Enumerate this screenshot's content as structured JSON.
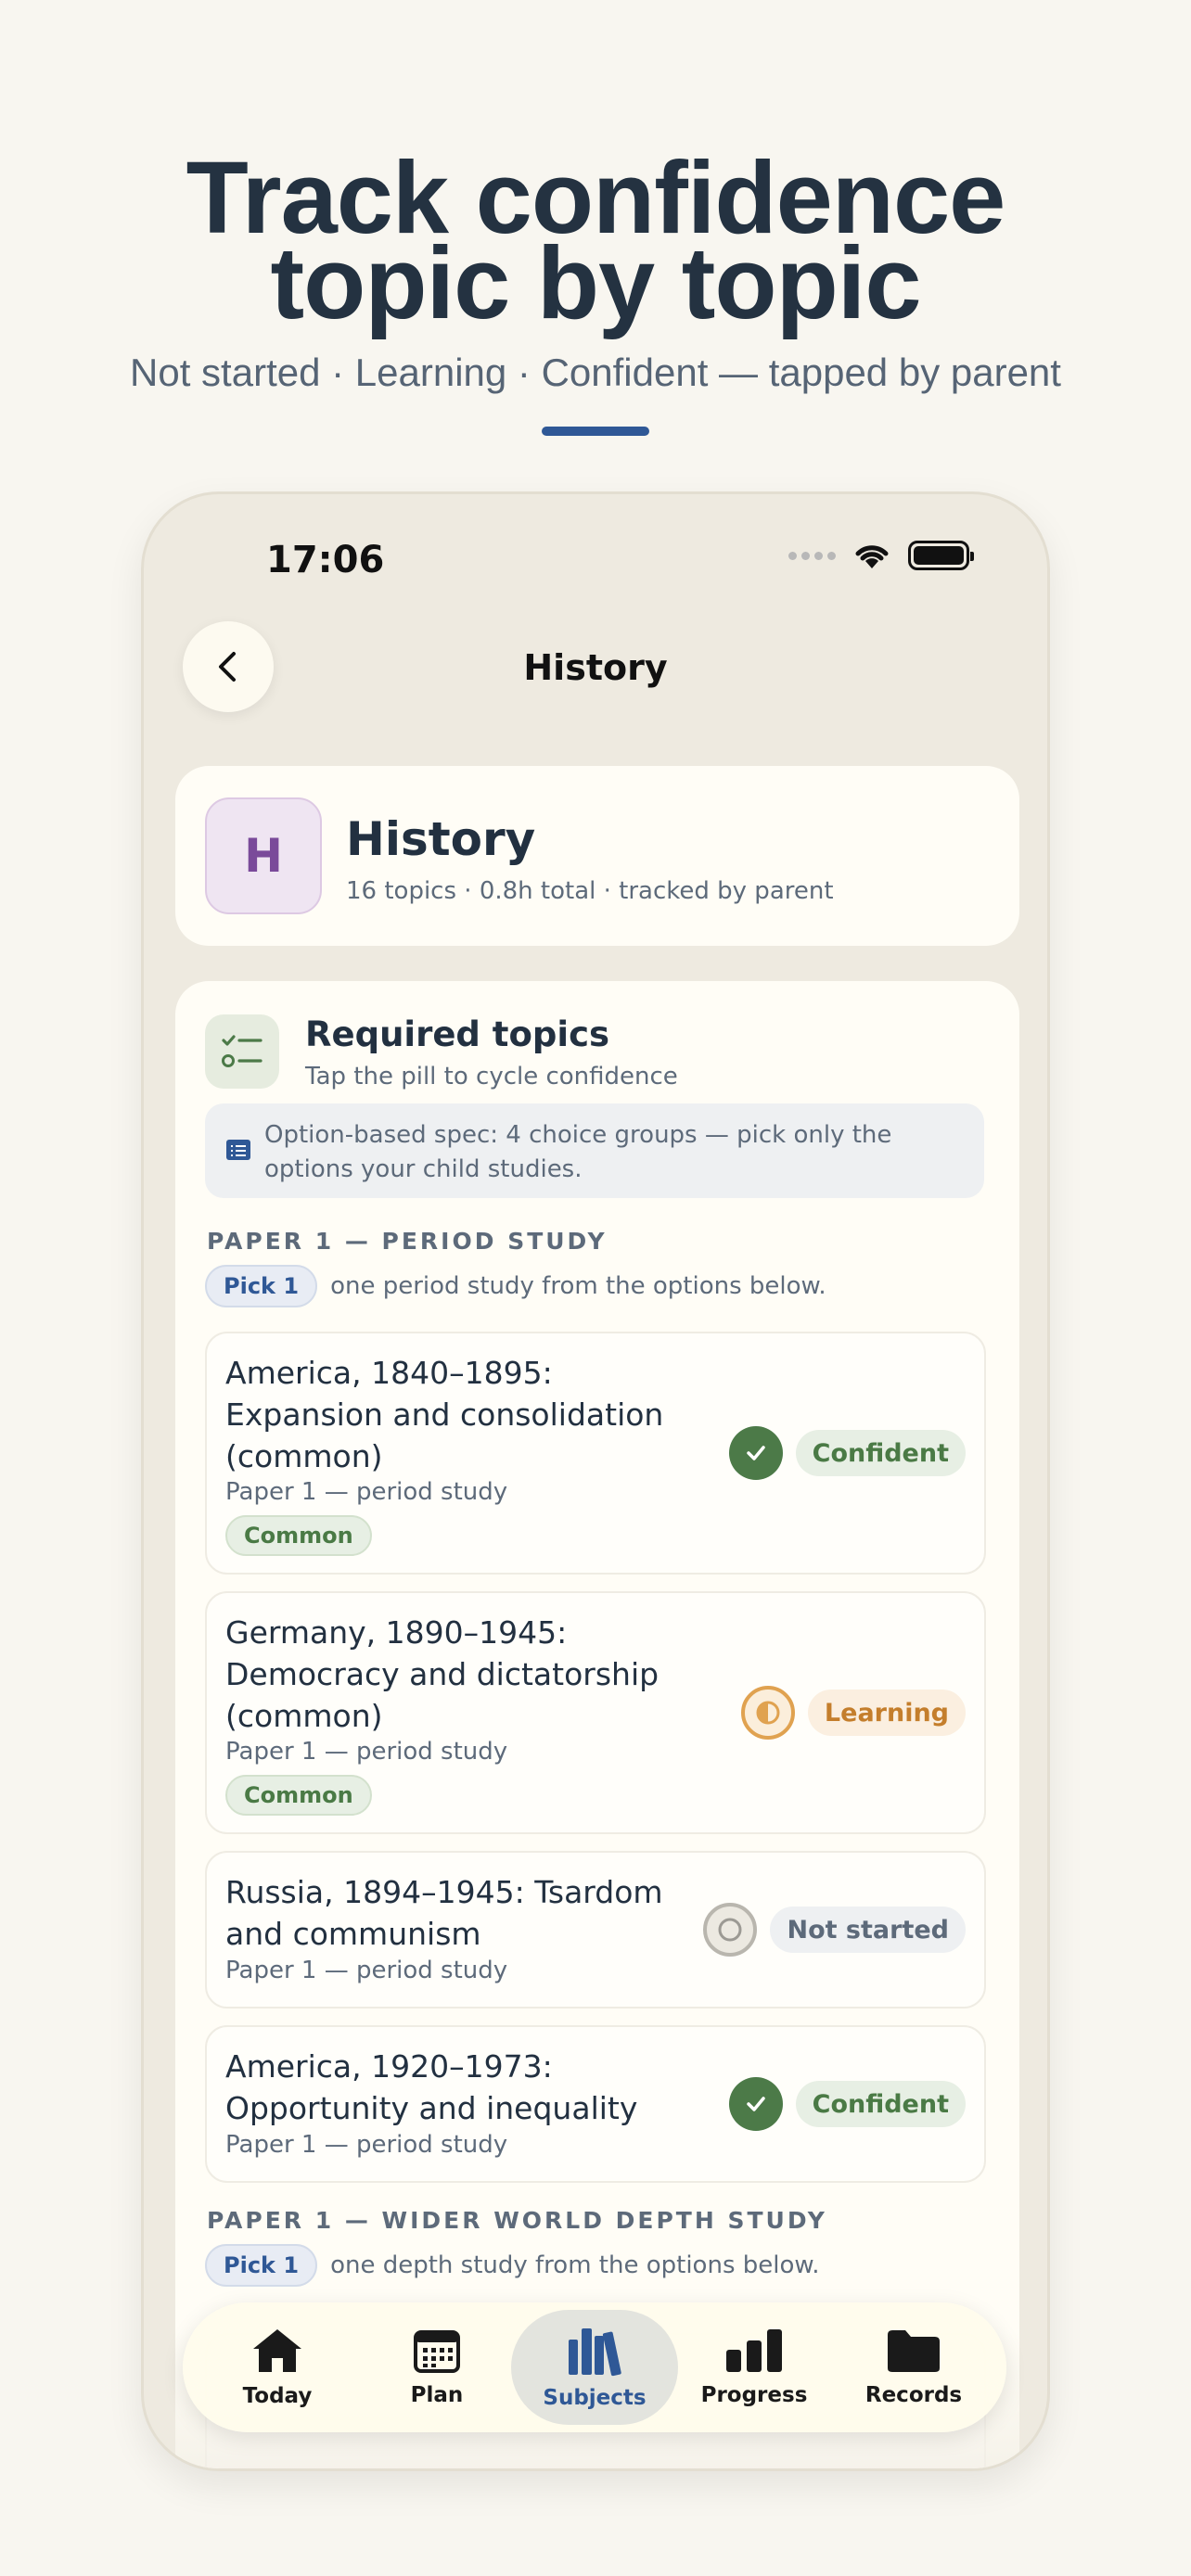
{
  "hero": {
    "title_line1": "Track confidence",
    "title_line2": "topic by topic",
    "subtitle": "Not started · Learning · Confident — tapped by parent",
    "accent_color": "#2f5896"
  },
  "status_bar": {
    "time": "17:06"
  },
  "nav": {
    "title": "History",
    "back_icon": "chevron-left-icon"
  },
  "subject": {
    "initial": "H",
    "name": "History",
    "meta": "16 topics · 0.8h total · tracked by parent"
  },
  "required": {
    "title": "Required topics",
    "subtitle": "Tap the pill to cycle confidence",
    "info": "Option-based spec: 4 choice groups — pick only the options your child studies."
  },
  "sections": [
    {
      "label": "PAPER 1 — PERIOD STUDY",
      "pick": "Pick 1",
      "pick_text": "one period study from the options below.",
      "topics": [
        {
          "title": "America, 1840–1895: Expansion and consolidation (common)",
          "sub": "Paper 1 — period study",
          "tag": "Common",
          "status": "Confident"
        },
        {
          "title": "Germany, 1890–1945: Democracy and dictatorship (common)",
          "sub": "Paper 1 — period study",
          "tag": "Common",
          "status": "Learning"
        },
        {
          "title": "Russia, 1894–1945: Tsardom and communism",
          "sub": "Paper 1 — period study",
          "status": "Not started"
        },
        {
          "title": "America, 1920–1973: Opportunity and inequality",
          "sub": "Paper 1 — period study",
          "status": "Confident"
        }
      ]
    },
    {
      "label": "PAPER 1 — WIDER WORLD DEPTH STUDY",
      "pick": "Pick 1",
      "pick_text": "one depth study from the options below."
    }
  ],
  "tabs": [
    {
      "label": "Today",
      "icon": "house-icon"
    },
    {
      "label": "Plan",
      "icon": "calendar-icon"
    },
    {
      "label": "Subjects",
      "icon": "books-icon",
      "active": true
    },
    {
      "label": "Progress",
      "icon": "bar-chart-icon"
    },
    {
      "label": "Records",
      "icon": "folder-icon"
    }
  ]
}
